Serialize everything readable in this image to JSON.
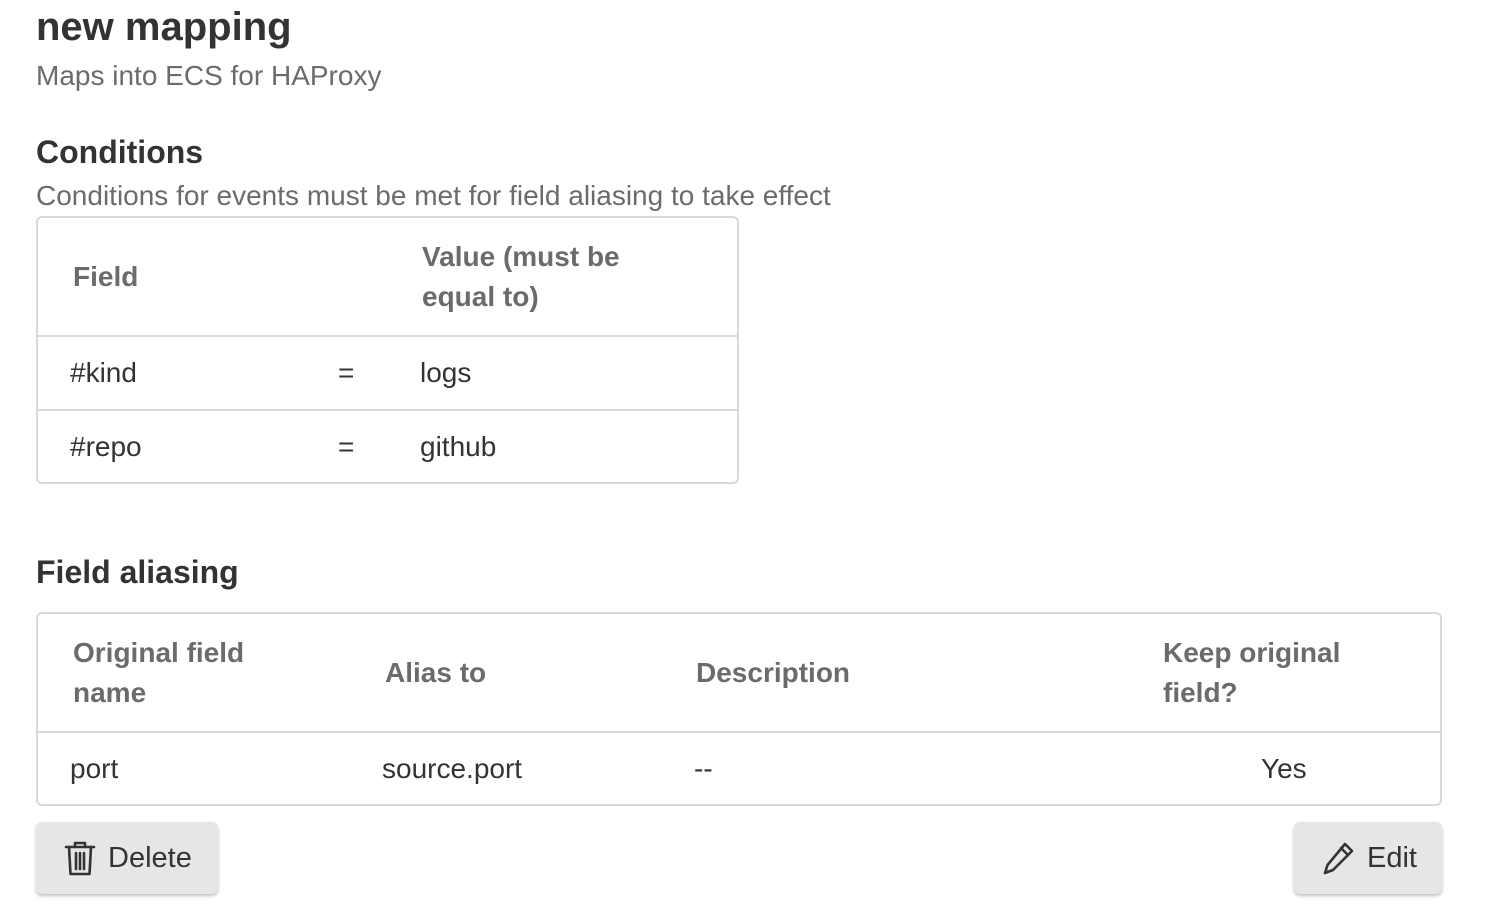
{
  "header": {
    "title": "new mapping",
    "subtitle": "Maps into ECS for HAProxy"
  },
  "conditions": {
    "heading": "Conditions",
    "description": "Conditions for events must be met for field aliasing to take effect",
    "columns": {
      "field": "Field",
      "value_line1": "Value (must be",
      "value_line2": "equal to)"
    },
    "rows": [
      {
        "field": "#kind",
        "operator": "=",
        "value": "logs"
      },
      {
        "field": "#repo",
        "operator": "=",
        "value": "github"
      }
    ]
  },
  "aliasing": {
    "heading": "Field aliasing",
    "columns": {
      "original_line1": "Original field",
      "original_line2": "name",
      "alias": "Alias to",
      "description": "Description",
      "keep_line1": "Keep original",
      "keep_line2": "field?"
    },
    "rows": [
      {
        "original": "port",
        "alias": "source.port",
        "description": "--",
        "keep": "Yes"
      }
    ]
  },
  "actions": {
    "delete_label": "Delete",
    "delete_icon": "trash-icon",
    "edit_label": "Edit",
    "edit_icon": "pencil-icon"
  }
}
